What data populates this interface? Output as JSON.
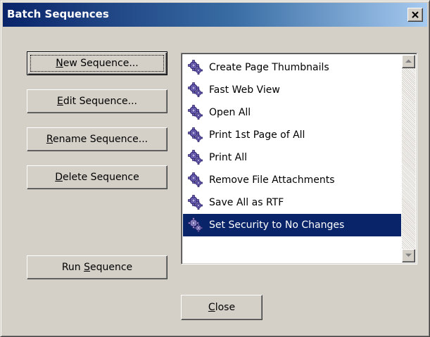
{
  "window": {
    "title": "Batch Sequences"
  },
  "buttons": {
    "new_sequence": {
      "pre": "",
      "key": "N",
      "post": "ew Sequence..."
    },
    "edit_sequence": {
      "pre": "",
      "key": "E",
      "post": "dit Sequence..."
    },
    "rename_sequence": {
      "pre": "",
      "key": "R",
      "post": "ename Sequence..."
    },
    "delete_sequence": {
      "pre": "",
      "key": "D",
      "post": "elete Sequence"
    },
    "run_sequence": {
      "pre": "Run ",
      "key": "S",
      "post": "equence"
    },
    "close": {
      "pre": "",
      "key": "C",
      "post": "lose"
    }
  },
  "sequences": [
    {
      "label": "Create Page Thumbnails",
      "icon": "gear-icon",
      "selected": false
    },
    {
      "label": "Fast Web View",
      "icon": "gear-icon",
      "selected": false
    },
    {
      "label": "Open All",
      "icon": "gear-icon",
      "selected": false
    },
    {
      "label": "Print 1st Page of All",
      "icon": "gear-icon",
      "selected": false
    },
    {
      "label": "Print All",
      "icon": "gear-icon",
      "selected": false
    },
    {
      "label": "Remove File Attachments",
      "icon": "gear-icon",
      "selected": false
    },
    {
      "label": "Save All as RTF",
      "icon": "gear-icon",
      "selected": false
    },
    {
      "label": "Set Security to No Changes",
      "icon": "gear-icon",
      "selected": true
    }
  ],
  "colors": {
    "titlebar_start": "#0a246a",
    "titlebar_end": "#a6caf0",
    "face": "#d4d0c8",
    "selection": "#0a246a",
    "gear_purple": "#6b5fb5"
  }
}
